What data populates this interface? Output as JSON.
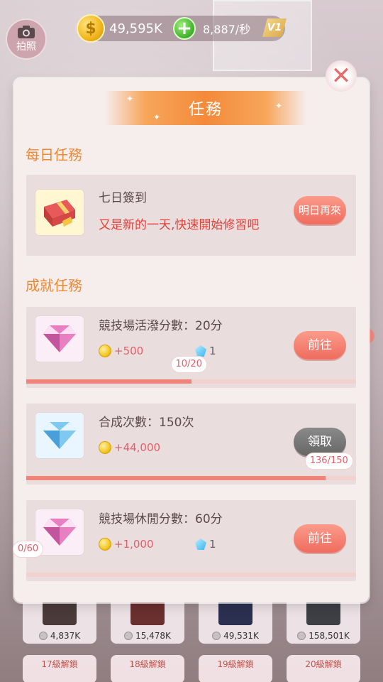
{
  "hud": {
    "camera_label": "拍照",
    "coin_symbol": "$",
    "coins": "49,595K",
    "rate": "8,887/秒",
    "vip": "V1"
  },
  "shop": {
    "items": [
      {
        "price": "4,837K",
        "color": "#4a3a3a"
      },
      {
        "price": "15,478K",
        "color": "#6a2f2f"
      },
      {
        "price": "49,531K",
        "color": "#2b3050"
      },
      {
        "price": "158,501K",
        "color": "#3d3f45"
      }
    ],
    "unlocks": [
      "17級解鎖",
      "18級解鎖",
      "19級解鎖",
      "20級解鎖"
    ]
  },
  "dialog": {
    "title": "任務",
    "close_symbol": "✕",
    "daily_heading": "每日任務",
    "daily": {
      "title": "七日簽到",
      "subtitle": "又是新的一天,快速開始修習吧",
      "button": "明日再來"
    },
    "achievement_heading": "成就任務",
    "achievements": [
      {
        "title": "競技場活潑分數：20分",
        "coins": "+500",
        "gems": "1",
        "button": "前往",
        "progress_text": "10/20",
        "progress": 0.5,
        "gem_color": "pink"
      },
      {
        "title": "合成次數：150次",
        "coins": "+44,000",
        "gems": "",
        "button": "領取",
        "progress_text": "136/150",
        "progress": 0.907,
        "gem_color": "blue"
      },
      {
        "title": "競技場休閒分數：60分",
        "coins": "+1,000",
        "gems": "1",
        "button": "前往",
        "progress_text": "0/60",
        "progress": 0.0,
        "gem_color": "pink"
      }
    ]
  }
}
